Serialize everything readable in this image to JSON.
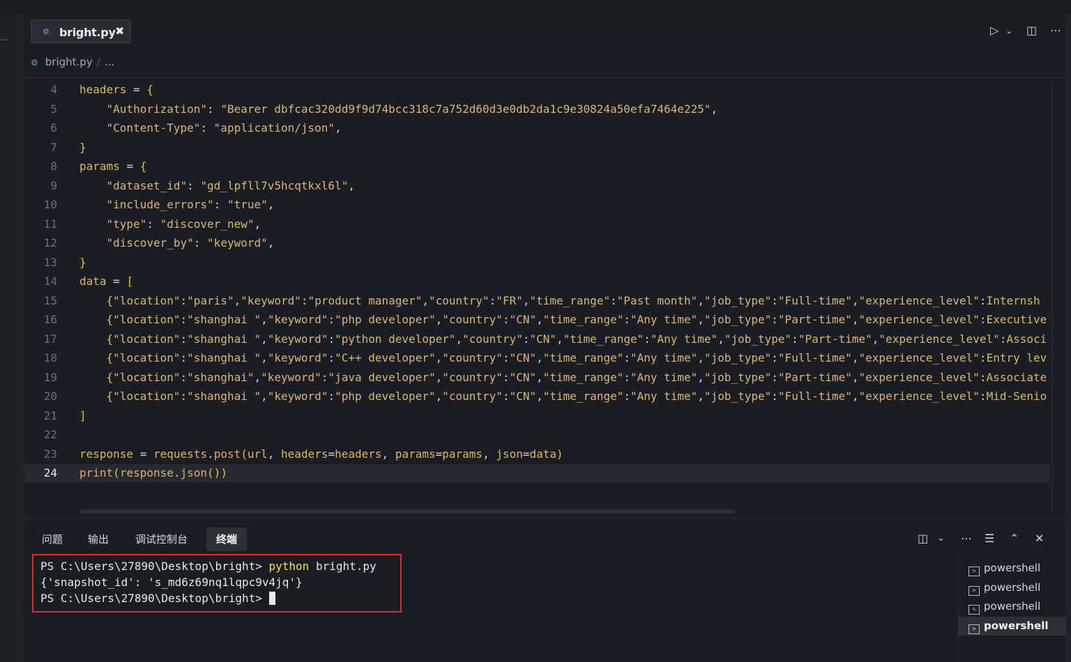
{
  "editor": {
    "tab": {
      "filename": "bright.py",
      "close_glyph": "✖"
    },
    "breadcrumb": {
      "file": "bright.py",
      "separator": "/",
      "rest": "..."
    },
    "toolbar": {
      "run_icon": "play-icon",
      "run_dropdown_icon": "chevron-down-icon",
      "split_icon": "split-editor-icon",
      "more_icon": "more-icon"
    },
    "active_line": 24,
    "lines": [
      {
        "n": "4",
        "text": "headers = {"
      },
      {
        "n": "5",
        "text": "    \"Authorization\": \"Bearer dbfcac320dd9f9d74bcc318c7a752d60d3e0db2da1c9e30824a50efa7464e225\","
      },
      {
        "n": "6",
        "text": "    \"Content-Type\": \"application/json\","
      },
      {
        "n": "7",
        "text": "}"
      },
      {
        "n": "8",
        "text": "params = {"
      },
      {
        "n": "9",
        "text": "    \"dataset_id\": \"gd_lpfll7v5hcqtkxl6l\","
      },
      {
        "n": "10",
        "text": "    \"include_errors\": \"true\","
      },
      {
        "n": "11",
        "text": "    \"type\": \"discover_new\","
      },
      {
        "n": "12",
        "text": "    \"discover_by\": \"keyword\","
      },
      {
        "n": "13",
        "text": "}"
      },
      {
        "n": "14",
        "text": "data = ["
      },
      {
        "n": "15",
        "text": "    {\"location\":\"paris\",\"keyword\":\"product manager\",\"country\":\"FR\",\"time_range\":\"Past month\",\"job_type\":\"Full-time\",\"experience_level\":\"Internsh"
      },
      {
        "n": "16",
        "text": "    {\"location\":\"shanghai \",\"keyword\":\"php developer\",\"country\":\"CN\",\"time_range\":\"Any time\",\"job_type\":\"Part-time\",\"experience_level\":\"Executive"
      },
      {
        "n": "17",
        "text": "    {\"location\":\"shanghai \",\"keyword\":\"python developer\",\"country\":\"CN\",\"time_range\":\"Any time\",\"job_type\":\"Part-time\",\"experience_level\":\"Associ"
      },
      {
        "n": "18",
        "text": "    {\"location\":\"shanghai \",\"keyword\":\"C++ developer\",\"country\":\"CN\",\"time_range\":\"Any time\",\"job_type\":\"Full-time\",\"experience_level\":\"Entry lev"
      },
      {
        "n": "19",
        "text": "    {\"location\":\"shanghai\",\"keyword\":\"java developer\",\"country\":\"CN\",\"time_range\":\"Any time\",\"job_type\":\"Part-time\",\"experience_level\":\"Associate"
      },
      {
        "n": "20",
        "text": "    {\"location\":\"shanghai \",\"keyword\":\"php developer\",\"country\":\"CN\",\"time_range\":\"Any time\",\"job_type\":\"Full-time\",\"experience_level\":\"Mid-Senio"
      },
      {
        "n": "21",
        "text": "]"
      },
      {
        "n": "22",
        "text": ""
      },
      {
        "n": "23",
        "text": "response = requests.post(url, headers=headers, params=params, json=data)"
      },
      {
        "n": "24",
        "text": "print(response.json())"
      }
    ]
  },
  "panel": {
    "tabs": [
      {
        "label": "问题"
      },
      {
        "label": "输出"
      },
      {
        "label": "调试控制台"
      },
      {
        "label": "终端"
      }
    ],
    "active_tab": "终端",
    "terminal": {
      "prompt1": "PS C:\\Users\\27890\\Desktop\\bright> ",
      "command": "python",
      "command_arg": " bright.py",
      "output": "{'snapshot_id': 's_md6z69nq1lqpc9v4jq'}",
      "prompt2": "PS C:\\Users\\27890\\Desktop\\bright> "
    },
    "shells": [
      {
        "label": "powershell",
        "icon": "terminal-icon"
      },
      {
        "label": "powershell",
        "icon": "terminal-icon"
      },
      {
        "label": "powershell",
        "icon": "terminal-edit-icon"
      },
      {
        "label": "powershell",
        "icon": "terminal-icon"
      }
    ]
  }
}
